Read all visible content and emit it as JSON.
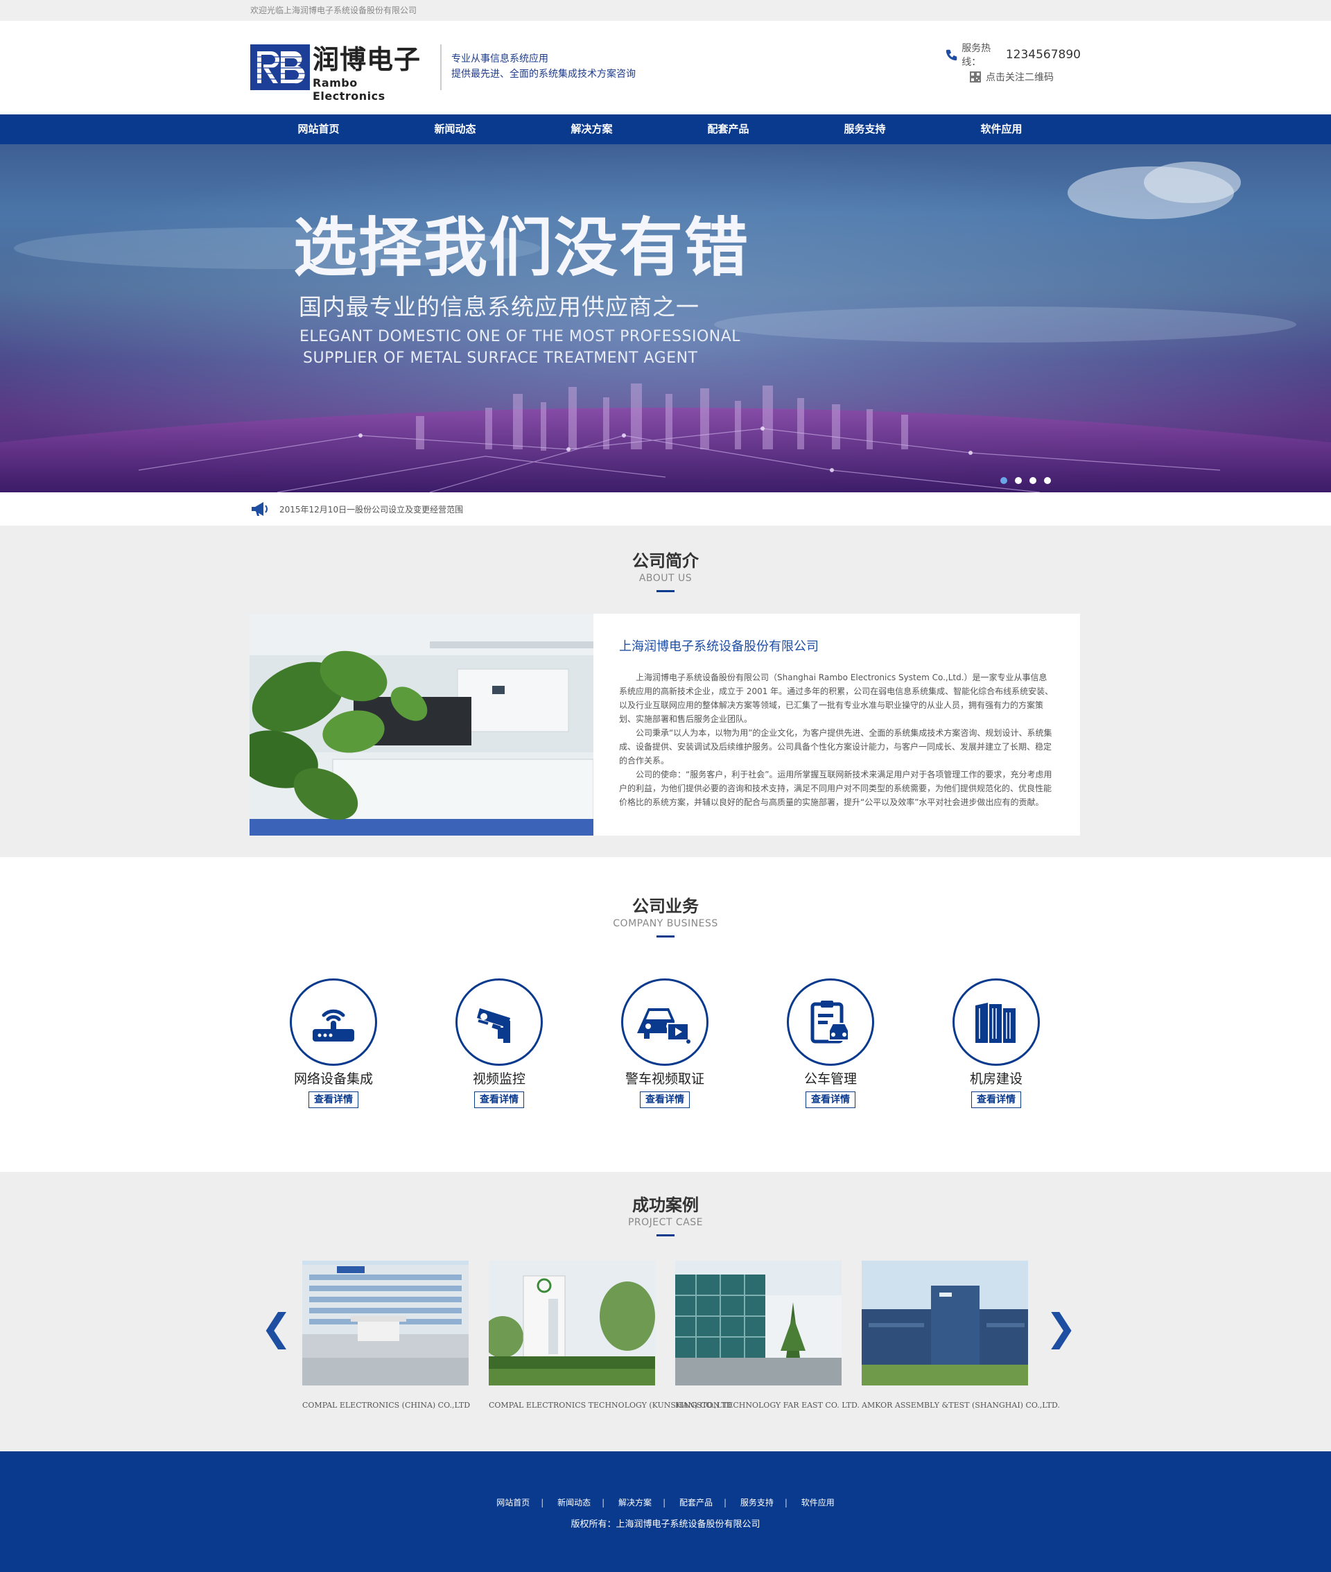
{
  "topbar": {
    "welcome": "欢迎光临上海润博电子系统设备股份有限公司"
  },
  "header": {
    "logo_cn": "润博电子",
    "logo_en": "Rambo Electronics",
    "slogan_1": "专业从事信息系统应用",
    "slogan_2": "提供最先进、全面的系统集成技术方案咨询",
    "hotline_label": "服务热线：",
    "hotline_number": "1234567890",
    "qr_label": "点击关注二维码"
  },
  "nav": {
    "items": [
      "网站首页",
      "新闻动态",
      "解决方案",
      "配套产品",
      "服务支持",
      "软件应用"
    ]
  },
  "banner": {
    "title": "选择我们没有错",
    "subtitle": "国内最专业的信息系统应用供应商之一",
    "en_line_1": "ELEGANT DOMESTIC ONE OF THE MOST PROFESSIONAL",
    "en_line_2": "SUPPLIER OF METAL SURFACE TREATMENT AGENT",
    "slide_count": 4,
    "active_slide": 1
  },
  "notice": {
    "text": "2015年12月10日一股份公司设立及变更经营范围"
  },
  "about": {
    "heading": "公司简介",
    "heading_en": "ABOUT US",
    "company_title": "上海润博电子系统设备股份有限公司",
    "paragraphs": [
      "上海润博电子系统设备股份有限公司（Shanghai Rambo Electronics System Co.,Ltd.）是一家专业从事信息系统应用的高新技术企业，成立于 2001 年。通过多年的积累，公司在弱电信息系统集成、智能化综合布线系统安装、以及行业互联网应用的整体解决方案等领域，已汇集了一批有专业水准与职业操守的从业人员，拥有强有力的方案策划、实施部署和售后服务企业团队。",
      "公司秉承“以人为本，以物为用”的企业文化，为客户提供先进、全面的系统集成技术方案咨询、规划设计、系统集成、设备提供、安装调试及后续维护服务。公司具备个性化方案设计能力，与客户一同成长、发展并建立了长期、稳定的合作关系。",
      "公司的使命：“服务客户，利于社会”。运用所掌握互联网新技术来满足用户对于各项管理工作的要求，充分考虑用户的利益，为他们提供必要的咨询和技术支持，满足不同用户对不同类型的系统需要，为他们提供规范化的、优良性能价格比的系统方案，并辅以良好的配合与高质量的实施部署，提升“公平以及效率”水平对社会进步做出应有的贡献。"
    ]
  },
  "business": {
    "heading": "公司业务",
    "heading_en": "COMPANY BUSINESS",
    "more_label": "查看详情",
    "items": [
      {
        "name": "网络设备集成",
        "icon": "router-icon"
      },
      {
        "name": "视频监控",
        "icon": "cctv-camera-icon"
      },
      {
        "name": "警车视频取证",
        "icon": "car-video-icon"
      },
      {
        "name": "公车管理",
        "icon": "car-clipboard-icon"
      },
      {
        "name": "机房建设",
        "icon": "server-rack-icon"
      }
    ]
  },
  "cases": {
    "heading": "成功案例",
    "heading_en": "PROJECT CASE",
    "prev_label": "❮",
    "next_label": "❯",
    "items": [
      {
        "caption": "COMPAL ELECTRONICS (CHINA) CO.,LTD"
      },
      {
        "caption": "COMPAL ELECTRONICS TECHNOLOGY (KUNSHAN) CO.,LTD"
      },
      {
        "caption": "KINGSTON TECHNOLOGY FAR EAST CO. LTD."
      },
      {
        "caption": "AMKOR ASSEMBLY &TEST (SHANGHAI) CO.,LTD."
      }
    ]
  },
  "footer": {
    "links": [
      "网站首页",
      "新闻动态",
      "解决方案",
      "配套产品",
      "服务支持",
      "软件应用"
    ],
    "copyright": "版权所有：上海润博电子系统设备股份有限公司"
  },
  "colors": {
    "brand_blue": "#0a3a8e",
    "accent_blue": "#1e4ea2",
    "section_gray": "#eeeeee"
  }
}
